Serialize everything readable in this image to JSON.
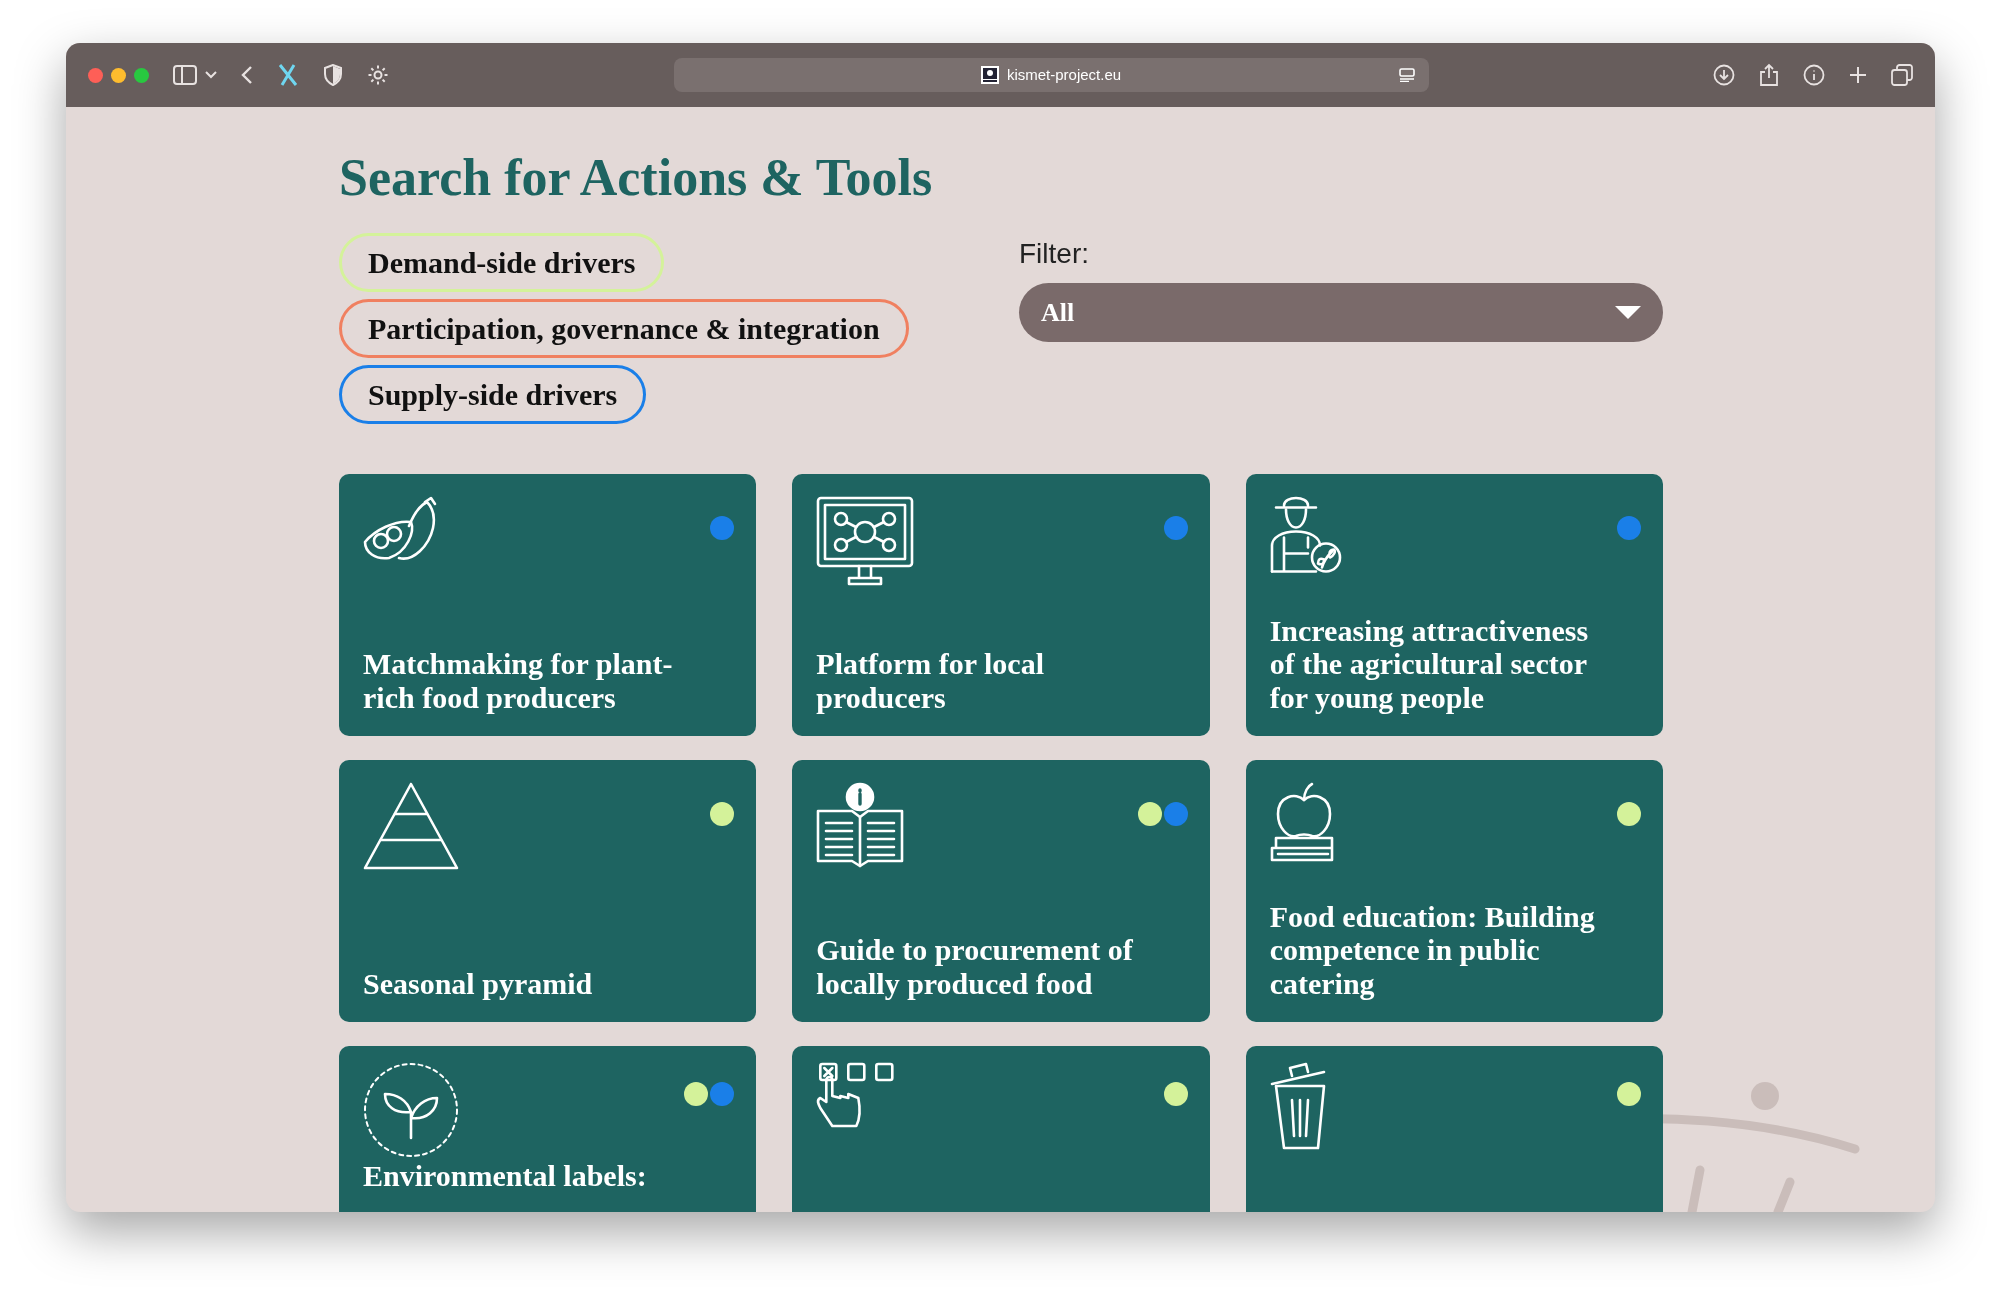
{
  "browser": {
    "url": "kismet-project.eu"
  },
  "heading": "Search for Actions & Tools",
  "categories": [
    {
      "label": "Demand-side drivers",
      "color": "#d4f29a"
    },
    {
      "label": "Participation, governance & integration",
      "color": "#f08060"
    },
    {
      "label": "Supply-side drivers",
      "color": "#1a7fe8"
    }
  ],
  "filter": {
    "label": "Filter:",
    "value": "All"
  },
  "cards": [
    {
      "title": "Matchmaking for plant-rich food producers",
      "dots": [
        {
          "color": "#1a7fe8"
        }
      ]
    },
    {
      "title": "Platform for local producers",
      "dots": [
        {
          "color": "#1a7fe8"
        }
      ]
    },
    {
      "title": "Increasing attractiveness of the agricultural sector for young people",
      "dots": [
        {
          "color": "#1a7fe8"
        }
      ]
    },
    {
      "title": "Seasonal pyramid",
      "dots": [
        {
          "color": "#d4f29a"
        }
      ]
    },
    {
      "title": "Guide to procurement of locally produced food",
      "dots": [
        {
          "color": "#d4f29a"
        },
        {
          "color": "#1a7fe8"
        }
      ]
    },
    {
      "title": "Food education: Building competence in public catering",
      "dots": [
        {
          "color": "#d4f29a"
        }
      ]
    },
    {
      "title": "Environmental labels:",
      "dots": [
        {
          "color": "#d4f29a"
        },
        {
          "color": "#1a7fe8"
        }
      ]
    },
    {
      "dots": [
        {
          "color": "#d4f29a"
        }
      ]
    },
    {
      "dots": [
        {
          "color": "#d4f29a"
        }
      ]
    }
  ]
}
